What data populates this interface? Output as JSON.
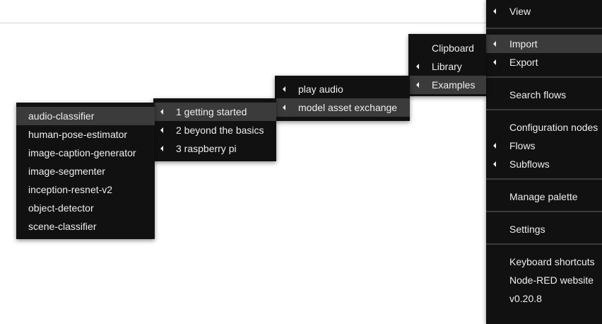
{
  "main_menu": {
    "items": [
      {
        "label": "View",
        "submenu": true
      },
      {
        "label": "Import",
        "submenu": true,
        "highlighted": true
      },
      {
        "label": "Export",
        "submenu": true
      },
      {
        "label": "Search flows",
        "submenu": false
      },
      {
        "label": "Configuration nodes",
        "submenu": false
      },
      {
        "label": "Flows",
        "submenu": true
      },
      {
        "label": "Subflows",
        "submenu": true
      },
      {
        "label": "Manage palette",
        "submenu": false
      },
      {
        "label": "Settings",
        "submenu": false
      },
      {
        "label": "Keyboard shortcuts",
        "submenu": false
      },
      {
        "label": "Node-RED website",
        "submenu": false
      },
      {
        "label": "v0.20.8",
        "submenu": false
      }
    ]
  },
  "import_menu": {
    "items": [
      {
        "label": "Clipboard",
        "submenu": false
      },
      {
        "label": "Library",
        "submenu": true
      },
      {
        "label": "Examples",
        "submenu": true,
        "highlighted": true
      }
    ]
  },
  "examples_menu": {
    "items": [
      {
        "label": "play audio",
        "submenu": true
      },
      {
        "label": "model asset exchange",
        "submenu": true,
        "highlighted": true
      }
    ]
  },
  "mae_menu": {
    "items": [
      {
        "label": "1 getting started",
        "submenu": true,
        "highlighted": true
      },
      {
        "label": "2 beyond the basics",
        "submenu": true
      },
      {
        "label": "3 raspberry pi",
        "submenu": true
      }
    ]
  },
  "getting_started_menu": {
    "items": [
      {
        "label": "audio-classifier",
        "highlighted": true
      },
      {
        "label": "human-pose-estimator"
      },
      {
        "label": "image-caption-generator"
      },
      {
        "label": "image-segmenter"
      },
      {
        "label": "inception-resnet-v2"
      },
      {
        "label": "object-detector"
      },
      {
        "label": "scene-classifier"
      }
    ]
  }
}
